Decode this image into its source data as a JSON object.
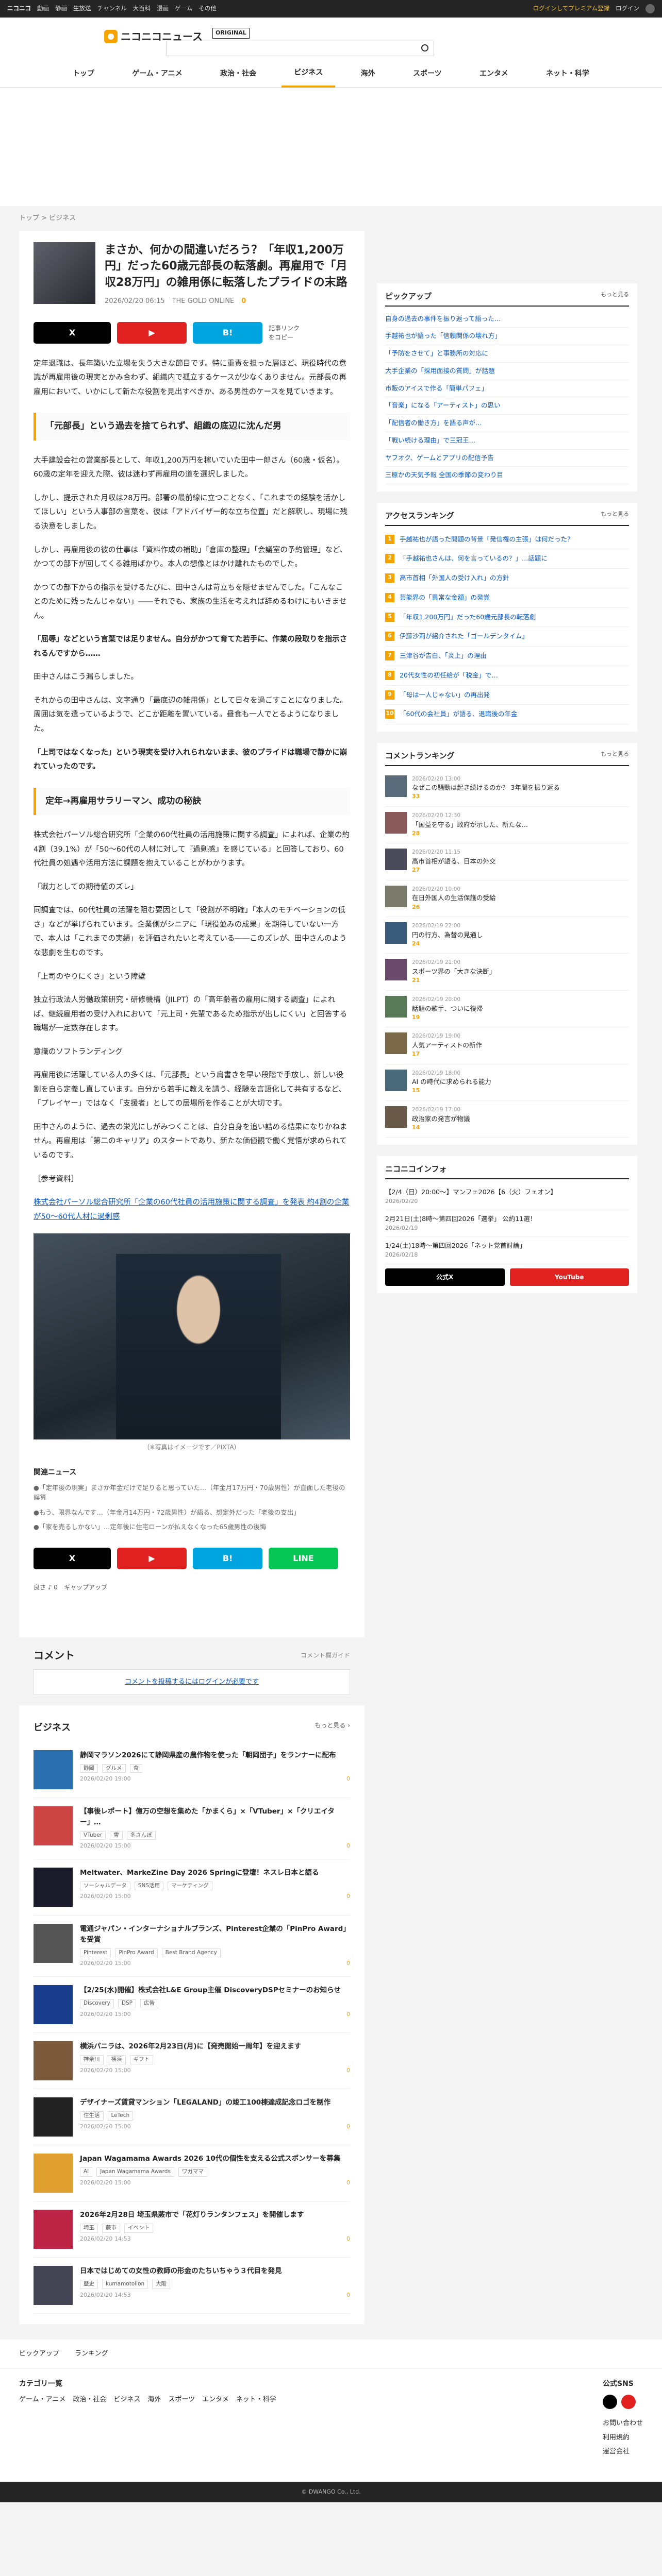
{
  "topbar": {
    "brand": "ニコニコ",
    "links": [
      "動画",
      "静画",
      "生放送",
      "チャンネル",
      "大百科",
      "漫画",
      "ゲーム",
      "その他"
    ],
    "premium": "ログインしてプレミアム登録",
    "login": "ログイン"
  },
  "header": {
    "logo": "ニコニコニュース",
    "tag": "ORIGINAL"
  },
  "gnav": [
    "トップ",
    "ゲーム・アニメ",
    "政治・社会",
    "ビジネス",
    "海外",
    "スポーツ",
    "エンタメ",
    "ネット・科学"
  ],
  "active_nav_index": 3,
  "breadcrumb": [
    "トップ",
    ">",
    "ビジネス"
  ],
  "article": {
    "title": "まさか、何かの間違いだろう？「年収1,200万円」だった60歳元部長の転落劇。再雇用で「月収28万円」の雑用係に転落したプライドの末路",
    "date": "2026/02/20 06:15",
    "source": "THE GOLD ONLINE",
    "comments": "0",
    "share": {
      "x": "X",
      "yt": "▶",
      "hb": "B!",
      "line": "LINE",
      "copy": "記事リンクをコピー"
    },
    "paragraphs_1": [
      "定年退職は、長年築いた立場を失う大きな節目です。特に重責を担った層ほど、現役時代の意識が再雇用後の現実とかみ合わず、組織内で孤立するケースが少なくありません。元部長の再雇用において、いかにして新たな役割を見出すべきか、ある男性のケースを見ていきます。"
    ],
    "h2_1": "「元部長」という過去を捨てられず、組織の底辺に沈んだ男",
    "paragraphs_2": [
      "大手建設会社の営業部長として、年収1,200万円を稼いでいた田中一郎さん（60歳・仮名）。60歳の定年を迎えた際、彼は迷わず再雇用の道を選択しました。",
      "しかし、提示された月収は28万円。部署の最前線に立つことなく、「これまでの経験を活かしてほしい」という人事部の言葉を、彼は「アドバイザー的な立ち位置」だと解釈し、現場に残る決意をしました。",
      "しかし、再雇用後の彼の仕事は「資料作成の補助」「倉庫の整理」「会議室の予約管理」など、かつての部下が回してくる雑用ばかり。本人の想像とはかけ離れたものでした。",
      "かつての部下からの指示を受けるたびに、田中さんは苛立ちを隠せませんでした。「こんなことのために残ったんじゃない」――それでも、家族の生活を考えれば辞めるわけにもいきません。"
    ],
    "quote_1": "「屈辱」などという言葉では足りません。自分がかつて育てた若手に、作業の段取りを指示されるんですから……",
    "paragraphs_3": [
      "田中さんはこう漏らしました。",
      "それからの田中さんは、文字通り「最底辺の雑用係」として日々を過ごすことになりました。周囲は気を遣っているようで、どこか距離を置いている。昼食も一人でとるようになりました。",
      "「上司ではなくなった」という現実を受け入れられないまま、彼のプライドは職場で静かに崩れていったのです。"
    ],
    "h2_2": "定年→再雇用サラリーマン、成功の秘訣",
    "paragraphs_4": [
      "株式会社パーソル総合研究所「企業の60代社員の活用施策に関する調査」によれば、企業の約4割（39.1%）が「50〜60代の人材に対して『過剰感』を感じている」と回答しており、60代社員の処遇や活用方法に課題を抱えていることがわかります。",
      "「戦力としての期待値のズレ」",
      "同調査では、60代社員の活躍を阻む要因として「役割が不明確」「本人のモチベーションの低さ」などが挙げられています。企業側がシニアに「現役並みの成果」を期待していない一方で、本人は「これまでの実績」を評価されたいと考えている――このズレが、田中さんのような悲劇を生むのです。",
      "「上司のやりにくさ」という障壁",
      "独立行政法人労働政策研究・研修機構（JILPT）の「高年齢者の雇用に関する調査」によれば、継続雇用者の受け入れにおいて「元上司・先輩であるため指示が出しにくい」と回答する職場が一定数存在します。",
      "意識のソフトランディング",
      "再雇用後に活躍している人の多くは、「元部長」という肩書きを早い段階で手放し、新しい役割を自ら定義し直しています。自分から若手に教えを請う、経験を言語化して共有するなど、「プレイヤー」ではなく「支援者」としての居場所を作ることが大切です。",
      "田中さんのように、過去の栄光にしがみつくことは、自分自身を追い詰める結果になりかねません。再雇用は「第二のキャリア」のスタートであり、新たな価値観で働く覚悟が求められているのです。"
    ],
    "sources_label": "［参考資料］",
    "source_link": "株式会社パーソル総合研究所「企業の60代社員の活用施策に関する調査」を発表 約4割の企業が50〜60代人材に過剰感",
    "caption": "（※写真はイメージです／PIXTA）",
    "related_title": "関連ニュース",
    "related": [
      "●「定年後の現実」まさか年金だけで足りると思っていた…（年金月17万円・70歳男性）が直面した老後の誤算",
      "●もう、限界なんです…（年金月14万円・72歳男性）が語る、想定外だった「老後の支出」",
      "●「家を売るしかない」…定年後に住宅ローンが払えなくなった65歳男性の後悔"
    ],
    "reactions": [
      "良さ ♪ 0",
      "ギャップアップ"
    ]
  },
  "comment": {
    "title": "コメント",
    "guide": "コメント欄ガイド",
    "login": "コメントを投稿するにはログインが必要です"
  },
  "business_news": {
    "title": "ビジネス",
    "more": "もっと見る ›",
    "items": [
      {
        "title": "静岡マラソン2026にて静岡県産の農作物を使った「朝岡団子」をランナーに配布",
        "tags": [
          "静岡",
          "グルメ",
          "食"
        ],
        "date": "2026/02/20 19:00",
        "c": "0"
      },
      {
        "title": "【事後レポート】億万の空想を集めた「かまくら」×「VTuber」×「クリエイター」…",
        "tags": [
          "VTuber",
          "雪",
          "冬さんぽ"
        ],
        "date": "2026/02/20 15:00",
        "c": "0"
      },
      {
        "title": "Meltwater、MarkeZine Day 2026 Springに登壇！ネスレ日本と語る",
        "tags": [
          "ソーシャルデータ",
          "SNS活用",
          "マーケティング"
        ],
        "date": "2026/02/20 15:00",
        "c": "0"
      },
      {
        "title": "電通ジャパン・インターナショナルブランズ、Pinterest企業の「PinPro Award」を受賞",
        "tags": [
          "Pinterest",
          "PinPro Award",
          "Best Brand Agency"
        ],
        "date": "2026/02/20 15:00",
        "c": "0"
      },
      {
        "title": "【2/25(水)開催】株式会社L&E Group主催 DiscoveryDSPセミナーのお知らせ",
        "tags": [
          "Discovery",
          "DSP",
          "広告"
        ],
        "date": "2026/02/20 15:00",
        "c": "0"
      },
      {
        "title": "横浜パニラは、2026年2月23日(月)に【発売開始一周年】を迎えます",
        "tags": [
          "神奈川",
          "横浜",
          "ギフト"
        ],
        "date": "2026/02/20 15:00",
        "c": "0"
      },
      {
        "title": "デザイナーズ賃貸マンション「LEGALAND」の竣工100棟達成記念ロゴを制作",
        "tags": [
          "住生活",
          "LeTech"
        ],
        "date": "2026/02/20 15:00",
        "c": "0"
      },
      {
        "title": "Japan Wagamama Awards 2026 10代の個性を支える公式スポンサーを募集",
        "tags": [
          "AI",
          "Japan Wagamama Awards",
          "ワガママ"
        ],
        "date": "2026/02/20 15:00",
        "c": "0"
      },
      {
        "title": "2026年2月28日 埼玉県蕨市で「花灯りランタンフェス」を開催します",
        "tags": [
          "埼玉",
          "蕨市",
          "イベント"
        ],
        "date": "2026/02/20 14:53",
        "c": "0"
      },
      {
        "title": "日本ではじめての女性の教師の形金のたちいちゃう３代目を発見",
        "tags": [
          "歴史",
          "kumamotolion",
          "大阪"
        ],
        "date": "2026/02/20 14:53",
        "c": "0"
      }
    ]
  },
  "side": {
    "pickup": {
      "title": "ピックアップ",
      "more": "もっと見る",
      "items": [
        "自身の過去の事件を振り返って語った…",
        "手越祐也が語った「信頼関係の壊れ方」",
        "「予防をさせて」と事務所の対応に",
        "大手企業の「採用面接の質問」が話題",
        "市販のアイスで作る「簡単パフェ」",
        "「音楽」になる「アーティスト」の思い",
        "「配信者の働き方」を語る声が…",
        "「戦い続ける理由」で三冠王…",
        "ヤフオク、ゲームとアプリの配信予告",
        "三原かの天気予報 全国の季節の変わり目"
      ]
    },
    "access": {
      "title": "アクセスランキング",
      "more": "もっと見る",
      "items": [
        "手越祐也が語った問題の背景「発信権の主張」は何だった？",
        "「手越祐也さんは、何を言っているの？」…話題に",
        "高市首相「外国人の受け入れ」の方針",
        "芸能界の「異常な金額」の発覚",
        "「年収1,200万円」だった60歳元部長の転落劇",
        "伊藤沙莉が紹介された「ゴールデンタイム」",
        "三津谷が告白、「炎上」の理由",
        "20代女性の初任給が「税金」で…",
        "「母は一人じゃない」の再出発",
        "「60代の会社員」が語る、退職後の年金"
      ]
    },
    "comments": {
      "title": "コメントランキング",
      "more": "もっと見る",
      "items": [
        {
          "t": "なぜこの騒動は起き続けるのか？ 3年間を振り返る",
          "d": "2026/02/20 13:00",
          "c": "33"
        },
        {
          "t": "「国益を守る」政府が示した、新たな…",
          "d": "2026/02/20 12:30",
          "c": "28"
        },
        {
          "t": "高市首相が語る、日本の外交",
          "d": "2026/02/20 11:15",
          "c": "27"
        },
        {
          "t": "在日外国人の生活保護の受給",
          "d": "2026/02/20 10:00",
          "c": "26"
        },
        {
          "t": "円の行方、為替の見通し",
          "d": "2026/02/19 22:00",
          "c": "24"
        },
        {
          "t": "スポーツ界の「大きな決断」",
          "d": "2026/02/19 21:00",
          "c": "21"
        },
        {
          "t": "話題の歌手、ついに復帰",
          "d": "2026/02/19 20:00",
          "c": "19"
        },
        {
          "t": "人気アーティストの新作",
          "d": "2026/02/19 19:00",
          "c": "17"
        },
        {
          "t": "AI の時代に求められる能力",
          "d": "2026/02/19 18:00",
          "c": "15"
        },
        {
          "t": "政治家の発言が物議",
          "d": "2026/02/19 17:00",
          "c": "14"
        }
      ]
    },
    "info": {
      "title": "ニコニコインフォ",
      "items": [
        {
          "t": "【2/4（日）20:00〜】マンフェ2026【6（火）フェオン】",
          "d": "2026/02/20"
        },
        {
          "t": "2月21日(土)8時〜第四回2026「選挙」 公約11選！",
          "d": "2026/02/19"
        },
        {
          "t": "1/24(土)18時〜第四回2026「ネット党首討論」",
          "d": "2026/02/18"
        }
      ]
    },
    "sns": {
      "x": "公式X",
      "yt": "YouTube"
    }
  },
  "footnav": [
    "ピックアップ",
    "ランキング"
  ],
  "footer": {
    "cat_title": "カテゴリ一覧",
    "cats": [
      "ゲーム・アニメ",
      "政治・社会",
      "ビジネス",
      "海外",
      "スポーツ",
      "エンタメ",
      "ネット・科学"
    ],
    "sns_title": "公式SNS",
    "links": [
      "お問い合わせ",
      "利用規約",
      "運営会社"
    ]
  },
  "copyright": "© DWANGO Co., Ltd."
}
